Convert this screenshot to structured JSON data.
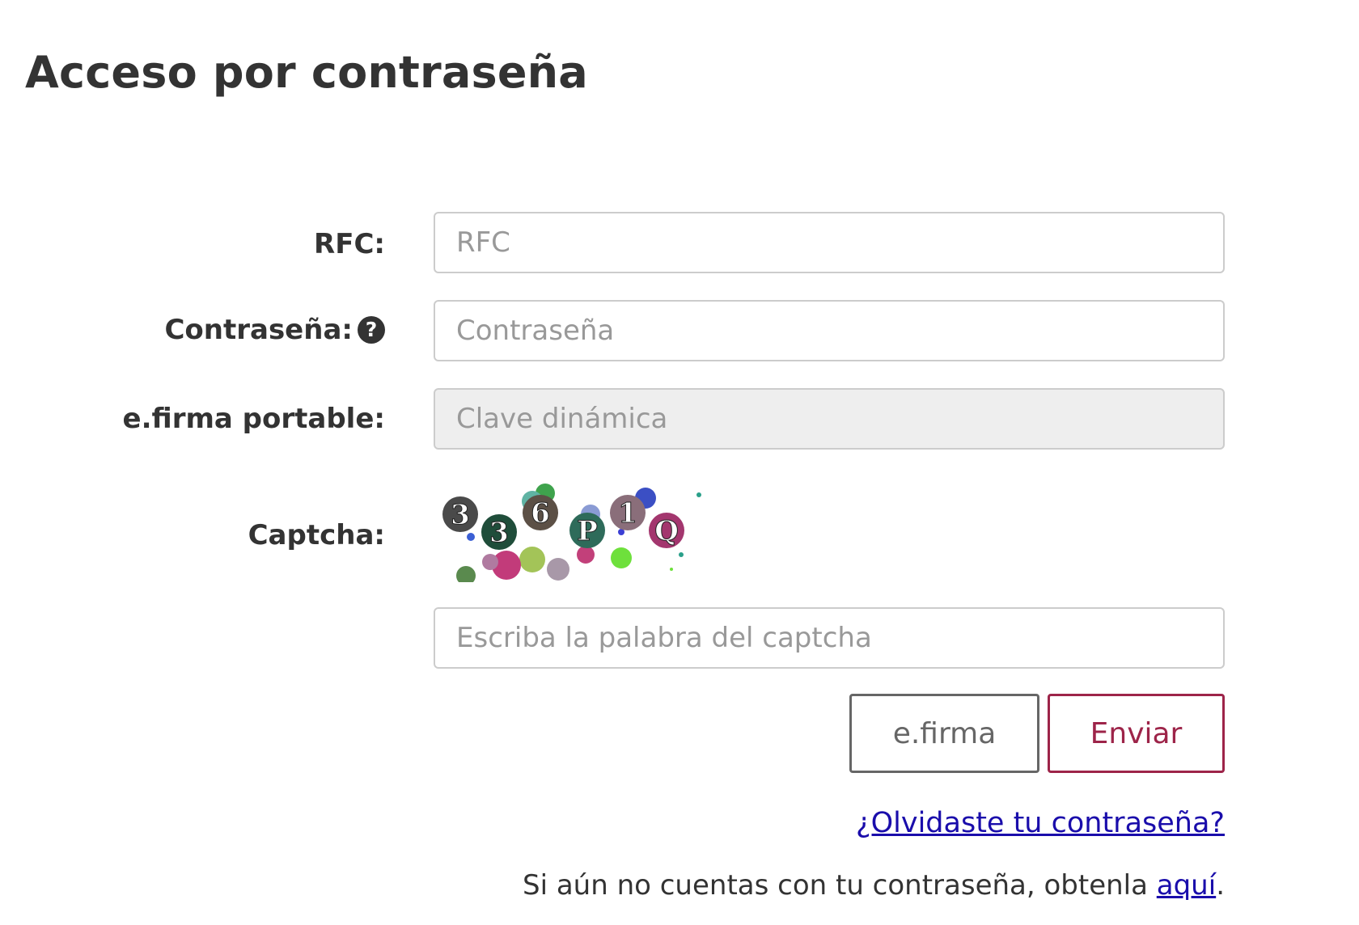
{
  "page": {
    "title": "Acceso por contraseña"
  },
  "form": {
    "rfc": {
      "label": "RFC:",
      "placeholder": "RFC"
    },
    "password": {
      "label": "Contraseña:",
      "placeholder": "Contraseña",
      "help_icon": "question-circle-icon",
      "help_glyph": "?"
    },
    "efirma_portable": {
      "label": "e.firma portable:",
      "placeholder": "Clave dinámica"
    },
    "captcha": {
      "label": "Captcha:",
      "image_text": [
        "3",
        "3",
        "6",
        "P",
        "1",
        "Q"
      ],
      "placeholder": "Escriba la palabra del captcha"
    }
  },
  "buttons": {
    "efirma_label": "e.firma",
    "enviar_label": "Enviar"
  },
  "links": {
    "forgot_password": "¿Olvidaste tu contraseña?",
    "signup_prefix": "Si aún no cuentas con tu contraseña, obtenla ",
    "signup_link": "aquí",
    "signup_suffix": "."
  },
  "colors": {
    "accent": "#9d2449",
    "link": "#1a0dab",
    "text": "#333333",
    "disabled_field": "#eeeeee"
  }
}
